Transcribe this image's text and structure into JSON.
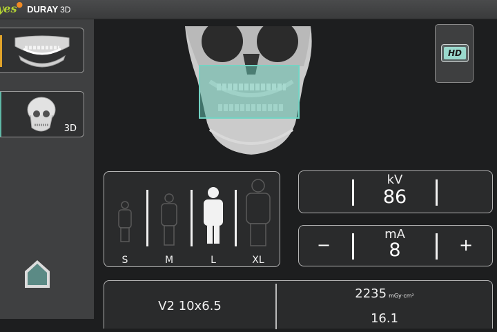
{
  "header": {
    "brand_prefix": "yes",
    "brand_model": "DURAY",
    "brand_suffix": "3D"
  },
  "sidebar": {
    "items": [
      {
        "name": "panoramic-jaw",
        "label": ""
      },
      {
        "name": "skull-3d",
        "label": "3D"
      }
    ]
  },
  "main": {
    "hd_label": "HD"
  },
  "patient_size": {
    "options": [
      {
        "label": "S",
        "selected": false
      },
      {
        "label": "M",
        "selected": false
      },
      {
        "label": "L",
        "selected": true
      },
      {
        "label": "XL",
        "selected": false
      }
    ]
  },
  "exposure": {
    "kv": {
      "label": "kV",
      "value": "86"
    },
    "ma": {
      "label": "mA",
      "value": "8",
      "minus": "−",
      "plus": "+"
    }
  },
  "info": {
    "fov": "V2 10x6.5",
    "dose_value": "2235",
    "dose_unit": "mGy·cm²",
    "line2": "16.1"
  },
  "colors": {
    "accent": "#5fb9a7",
    "selected_bar": "#e0a32a",
    "brand_green": "#b3d234"
  }
}
